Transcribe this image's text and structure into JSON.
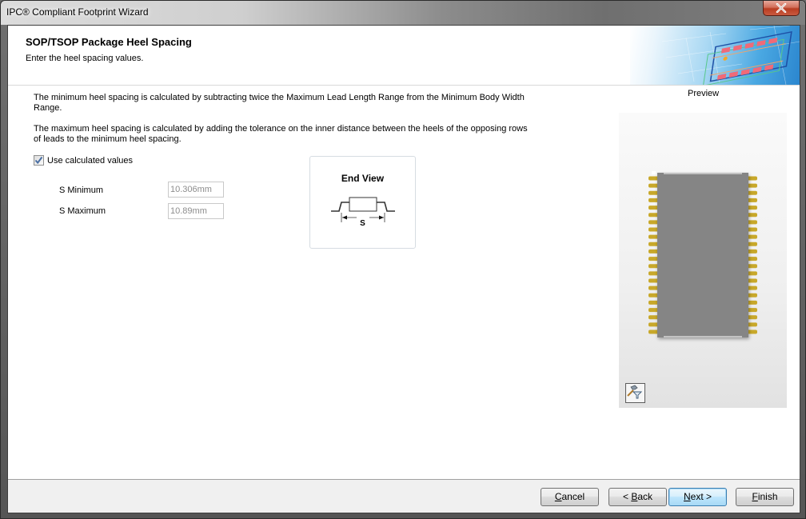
{
  "window": {
    "title": "IPC® Compliant Footprint Wizard",
    "close_icon": "close-x-icon"
  },
  "header": {
    "title": "SOP/TSOP Package Heel Spacing",
    "subtitle": "Enter the heel spacing values."
  },
  "content": {
    "paragraph_min": "The minimum heel spacing is calculated by subtracting twice the Maximum Lead Length Range from the Minimum Body Width Range.",
    "paragraph_max": "The maximum heel spacing is calculated by adding the tolerance on the inner distance between the heels of the opposing rows of leads to the minimum heel spacing.",
    "use_calculated": {
      "label": "Use calculated values",
      "checked": true
    },
    "fields": {
      "s_min": {
        "label": "S Minimum",
        "value": "10.306mm"
      },
      "s_max": {
        "label": "S Maximum",
        "value": "10.89mm"
      }
    },
    "end_view": {
      "title": "End View",
      "dimension_label": "S"
    }
  },
  "preview": {
    "label": "Preview",
    "pins_per_side": 22,
    "pin_color": "#c8a82a",
    "body_color": "#858585",
    "tool_icon": "hammer-funnel-icon"
  },
  "footer": {
    "buttons": {
      "cancel": {
        "mnemonic": "C",
        "rest": "ancel"
      },
      "back": {
        "prefix": "< ",
        "mnemonic": "B",
        "rest": "ack"
      },
      "next": {
        "mnemonic": "N",
        "rest": "ext >"
      },
      "finish": {
        "mnemonic": "F",
        "rest": "inish"
      }
    }
  }
}
